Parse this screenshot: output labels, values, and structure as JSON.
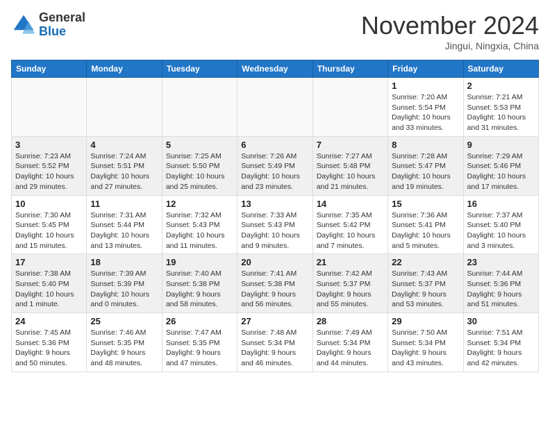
{
  "header": {
    "logo_line1": "General",
    "logo_line2": "Blue",
    "month": "November 2024",
    "location": "Jingui, Ningxia, China"
  },
  "weekdays": [
    "Sunday",
    "Monday",
    "Tuesday",
    "Wednesday",
    "Thursday",
    "Friday",
    "Saturday"
  ],
  "weeks": [
    [
      {
        "day": "",
        "info": ""
      },
      {
        "day": "",
        "info": ""
      },
      {
        "day": "",
        "info": ""
      },
      {
        "day": "",
        "info": ""
      },
      {
        "day": "",
        "info": ""
      },
      {
        "day": "1",
        "info": "Sunrise: 7:20 AM\nSunset: 5:54 PM\nDaylight: 10 hours and 33 minutes."
      },
      {
        "day": "2",
        "info": "Sunrise: 7:21 AM\nSunset: 5:53 PM\nDaylight: 10 hours and 31 minutes."
      }
    ],
    [
      {
        "day": "3",
        "info": "Sunrise: 7:23 AM\nSunset: 5:52 PM\nDaylight: 10 hours and 29 minutes."
      },
      {
        "day": "4",
        "info": "Sunrise: 7:24 AM\nSunset: 5:51 PM\nDaylight: 10 hours and 27 minutes."
      },
      {
        "day": "5",
        "info": "Sunrise: 7:25 AM\nSunset: 5:50 PM\nDaylight: 10 hours and 25 minutes."
      },
      {
        "day": "6",
        "info": "Sunrise: 7:26 AM\nSunset: 5:49 PM\nDaylight: 10 hours and 23 minutes."
      },
      {
        "day": "7",
        "info": "Sunrise: 7:27 AM\nSunset: 5:48 PM\nDaylight: 10 hours and 21 minutes."
      },
      {
        "day": "8",
        "info": "Sunrise: 7:28 AM\nSunset: 5:47 PM\nDaylight: 10 hours and 19 minutes."
      },
      {
        "day": "9",
        "info": "Sunrise: 7:29 AM\nSunset: 5:46 PM\nDaylight: 10 hours and 17 minutes."
      }
    ],
    [
      {
        "day": "10",
        "info": "Sunrise: 7:30 AM\nSunset: 5:45 PM\nDaylight: 10 hours and 15 minutes."
      },
      {
        "day": "11",
        "info": "Sunrise: 7:31 AM\nSunset: 5:44 PM\nDaylight: 10 hours and 13 minutes."
      },
      {
        "day": "12",
        "info": "Sunrise: 7:32 AM\nSunset: 5:43 PM\nDaylight: 10 hours and 11 minutes."
      },
      {
        "day": "13",
        "info": "Sunrise: 7:33 AM\nSunset: 5:43 PM\nDaylight: 10 hours and 9 minutes."
      },
      {
        "day": "14",
        "info": "Sunrise: 7:35 AM\nSunset: 5:42 PM\nDaylight: 10 hours and 7 minutes."
      },
      {
        "day": "15",
        "info": "Sunrise: 7:36 AM\nSunset: 5:41 PM\nDaylight: 10 hours and 5 minutes."
      },
      {
        "day": "16",
        "info": "Sunrise: 7:37 AM\nSunset: 5:40 PM\nDaylight: 10 hours and 3 minutes."
      }
    ],
    [
      {
        "day": "17",
        "info": "Sunrise: 7:38 AM\nSunset: 5:40 PM\nDaylight: 10 hours and 1 minute."
      },
      {
        "day": "18",
        "info": "Sunrise: 7:39 AM\nSunset: 5:39 PM\nDaylight: 10 hours and 0 minutes."
      },
      {
        "day": "19",
        "info": "Sunrise: 7:40 AM\nSunset: 5:38 PM\nDaylight: 9 hours and 58 minutes."
      },
      {
        "day": "20",
        "info": "Sunrise: 7:41 AM\nSunset: 5:38 PM\nDaylight: 9 hours and 56 minutes."
      },
      {
        "day": "21",
        "info": "Sunrise: 7:42 AM\nSunset: 5:37 PM\nDaylight: 9 hours and 55 minutes."
      },
      {
        "day": "22",
        "info": "Sunrise: 7:43 AM\nSunset: 5:37 PM\nDaylight: 9 hours and 53 minutes."
      },
      {
        "day": "23",
        "info": "Sunrise: 7:44 AM\nSunset: 5:36 PM\nDaylight: 9 hours and 51 minutes."
      }
    ],
    [
      {
        "day": "24",
        "info": "Sunrise: 7:45 AM\nSunset: 5:36 PM\nDaylight: 9 hours and 50 minutes."
      },
      {
        "day": "25",
        "info": "Sunrise: 7:46 AM\nSunset: 5:35 PM\nDaylight: 9 hours and 48 minutes."
      },
      {
        "day": "26",
        "info": "Sunrise: 7:47 AM\nSunset: 5:35 PM\nDaylight: 9 hours and 47 minutes."
      },
      {
        "day": "27",
        "info": "Sunrise: 7:48 AM\nSunset: 5:34 PM\nDaylight: 9 hours and 46 minutes."
      },
      {
        "day": "28",
        "info": "Sunrise: 7:49 AM\nSunset: 5:34 PM\nDaylight: 9 hours and 44 minutes."
      },
      {
        "day": "29",
        "info": "Sunrise: 7:50 AM\nSunset: 5:34 PM\nDaylight: 9 hours and 43 minutes."
      },
      {
        "day": "30",
        "info": "Sunrise: 7:51 AM\nSunset: 5:34 PM\nDaylight: 9 hours and 42 minutes."
      }
    ]
  ]
}
